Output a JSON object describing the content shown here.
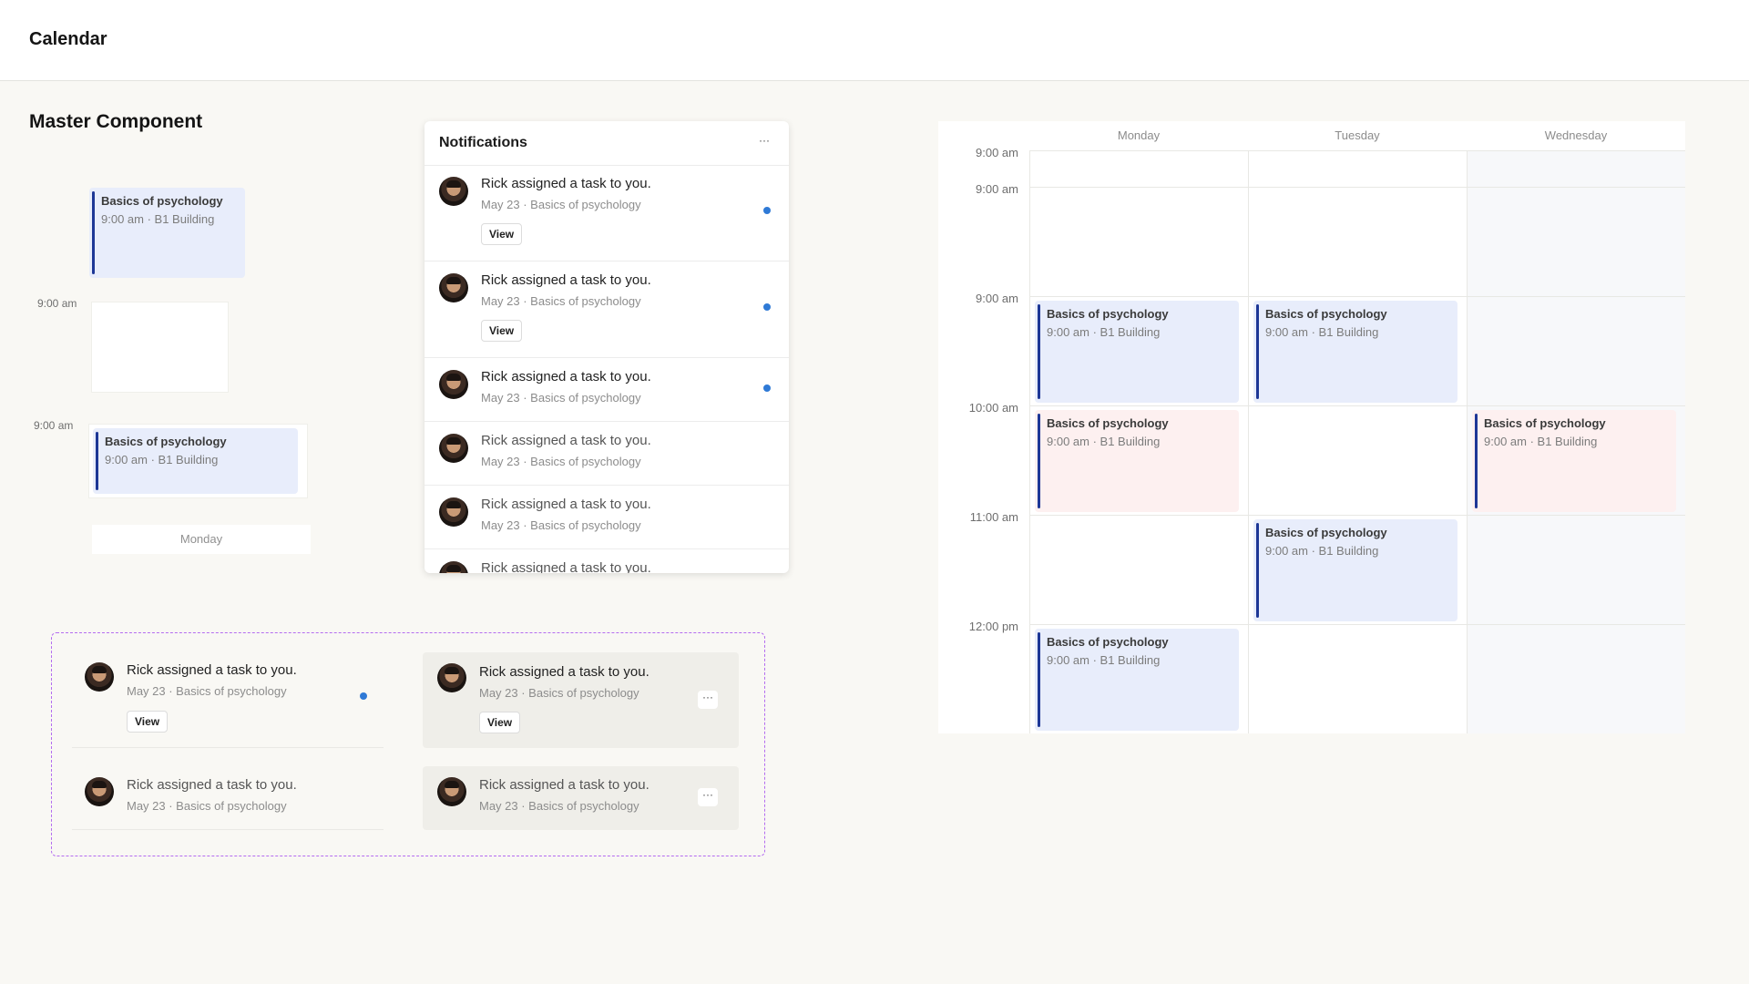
{
  "app": {
    "title": "Calendar"
  },
  "section": {
    "title": "Master Component"
  },
  "demo": {
    "event_top": {
      "title": "Basics of psychology",
      "sub": "9:00 am · B1 Building"
    },
    "time_a": "9:00 am",
    "time_b": "9:00 am",
    "event_bottom": {
      "title": "Basics of psychology",
      "sub": "9:00 am · B1 Building"
    },
    "day_label": "Monday"
  },
  "notifications": {
    "title": "Notifications",
    "menu_icon": "more-horizontal-icon",
    "items": [
      {
        "text": "Rick assigned a task to you.",
        "meta": "May 23 · Basics of psychology",
        "action": "View",
        "unread": true
      },
      {
        "text": "Rick assigned a task to you.",
        "meta": "May 23 · Basics of psychology",
        "action": "View",
        "unread": true
      },
      {
        "text": "Rick assigned a task to you.",
        "meta": "May 23 · Basics of psychology",
        "unread": true
      },
      {
        "text": "Rick assigned a task to you.",
        "meta": "May 23 · Basics of psychology",
        "unread": false
      },
      {
        "text": "Rick assigned a task to you.",
        "meta": "May 23 · Basics of psychology",
        "unread": false
      },
      {
        "text": "Rick assigned a task to you.",
        "meta": "",
        "unread": false
      }
    ]
  },
  "variants": {
    "unread_action": {
      "text": "Rick assigned a task to you.",
      "meta": "May 23 · Basics of psychology",
      "action": "View"
    },
    "hover_action": {
      "text": "Rick assigned a task to you.",
      "meta": "May 23 · Basics of psychology",
      "action": "View",
      "menu": "···"
    },
    "read": {
      "text": "Rick assigned a task to you.",
      "meta": "May 23 · Basics of psychology"
    },
    "hover_read": {
      "text": "Rick assigned a task to you.",
      "meta": "May 23 · Basics of psychology",
      "menu": "···"
    }
  },
  "week": {
    "days": [
      "Monday",
      "Tuesday",
      "Wednesday"
    ],
    "times": [
      "9:00 am",
      "9:00 am",
      "9:00 am",
      "10:00 am",
      "11:00 am",
      "12:00 pm"
    ],
    "events": [
      {
        "title": "Basics of psychology",
        "sub": "9:00 am · B1 Building",
        "color": "blue"
      },
      {
        "title": "Basics of psychology",
        "sub": "9:00 am · B1 Building",
        "color": "blue"
      },
      {
        "title": "Basics of psychology",
        "sub": "9:00 am · B1 Building",
        "color": "pink"
      },
      {
        "title": "Basics of psychology",
        "sub": "9:00 am · B1 Building",
        "color": "pink"
      },
      {
        "title": "Basics of psychology",
        "sub": "9:00 am · B1 Building",
        "color": "blue"
      },
      {
        "title": "Basics of psychology",
        "sub": "9:00 am · B1 Building",
        "color": "blue"
      }
    ]
  },
  "colors": {
    "accent": "#1d3796",
    "unread": "#2f7ad6",
    "event_blue": "#e8edfb",
    "event_pink": "#fdf0f0",
    "variant_border": "#b46cf0"
  }
}
